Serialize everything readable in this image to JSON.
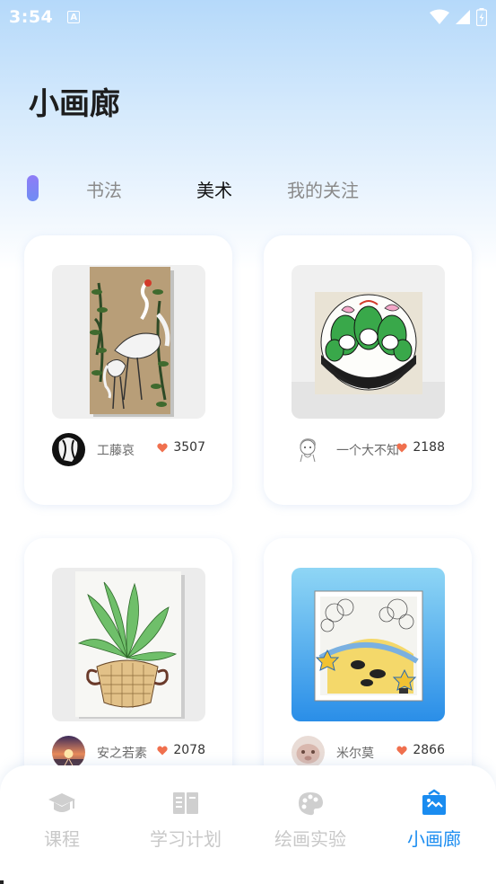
{
  "status_bar": {
    "time": "3:54",
    "notification_badge": "A"
  },
  "page": {
    "title": "小画廊"
  },
  "tabs": [
    {
      "label": "书法",
      "active": false
    },
    {
      "label": "美术",
      "active": true
    },
    {
      "label": "我的关注",
      "active": false
    }
  ],
  "cards": [
    {
      "author": "工藤哀",
      "likes": "3507"
    },
    {
      "author": "一个大不知",
      "likes": "2188"
    },
    {
      "author": "安之若素",
      "likes": "2078"
    },
    {
      "author": "米尔莫",
      "likes": "2866"
    }
  ],
  "bottom_nav": [
    {
      "label": "课程",
      "icon": "graduation-cap-icon",
      "active": false
    },
    {
      "label": "学习计划",
      "icon": "book-icon",
      "active": false
    },
    {
      "label": "绘画实验",
      "icon": "palette-icon",
      "active": false
    },
    {
      "label": "小画廊",
      "icon": "gallery-icon",
      "active": true
    }
  ],
  "colors": {
    "accent": "#1a8cf0",
    "heart": "#f0704e",
    "tab_indicator": "#7f84f5"
  }
}
